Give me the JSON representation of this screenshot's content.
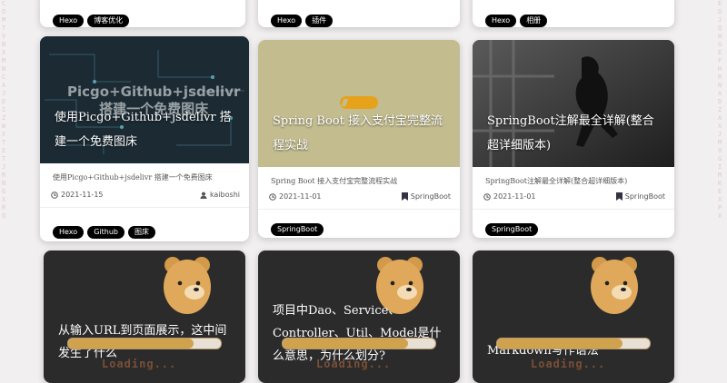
{
  "top_row": [
    {
      "tags": [
        "Hexo",
        "博客优化"
      ]
    },
    {
      "tags": [
        "Hexo",
        "插件"
      ]
    },
    {
      "tags": [
        "Hexo",
        "相册"
      ]
    }
  ],
  "middle_row": [
    {
      "cover_text": "Picgo+Github+jsdelivr\n搭建一个免费图床",
      "title": "使用Picgo+Github+jsdelivr 搭建一个免费图床",
      "summary": "使用Picgo+Github+jsdelivr 搭建一个免费图床",
      "date": "2021-11-15",
      "author": "kaiboshi",
      "tags": [
        "Hexo",
        "Github",
        "图床"
      ]
    },
    {
      "title": "Spring Boot 接入支付宝完整流程实战",
      "summary": "Spring Boot 接入支付宝完整流程实战",
      "date": "2021-11-01",
      "category": "SpringBoot",
      "tags": [
        "SpringBoot"
      ],
      "cover_color": "#c3bc8f"
    },
    {
      "title": "SpringBoot注解最全详解(整合超详细版本)",
      "summary": "SpringBoot注解最全详解(整合超详细版本)",
      "date": "2021-11-01",
      "category": "SpringBoot",
      "tags": [
        "SpringBoot"
      ]
    }
  ],
  "bottom_row": [
    {
      "title": "从输入URL到页面展示，这中间发生了什么",
      "loading": "Loading...",
      "progress": 0.82
    },
    {
      "title": "项目中Dao、Service、Controller、Util、Model是什么意思，为什么划分?",
      "loading": "Loading...",
      "progress": 0.82
    },
    {
      "title": "Markdown写作语法",
      "loading": "Loading...",
      "progress": 0.82
    }
  ]
}
